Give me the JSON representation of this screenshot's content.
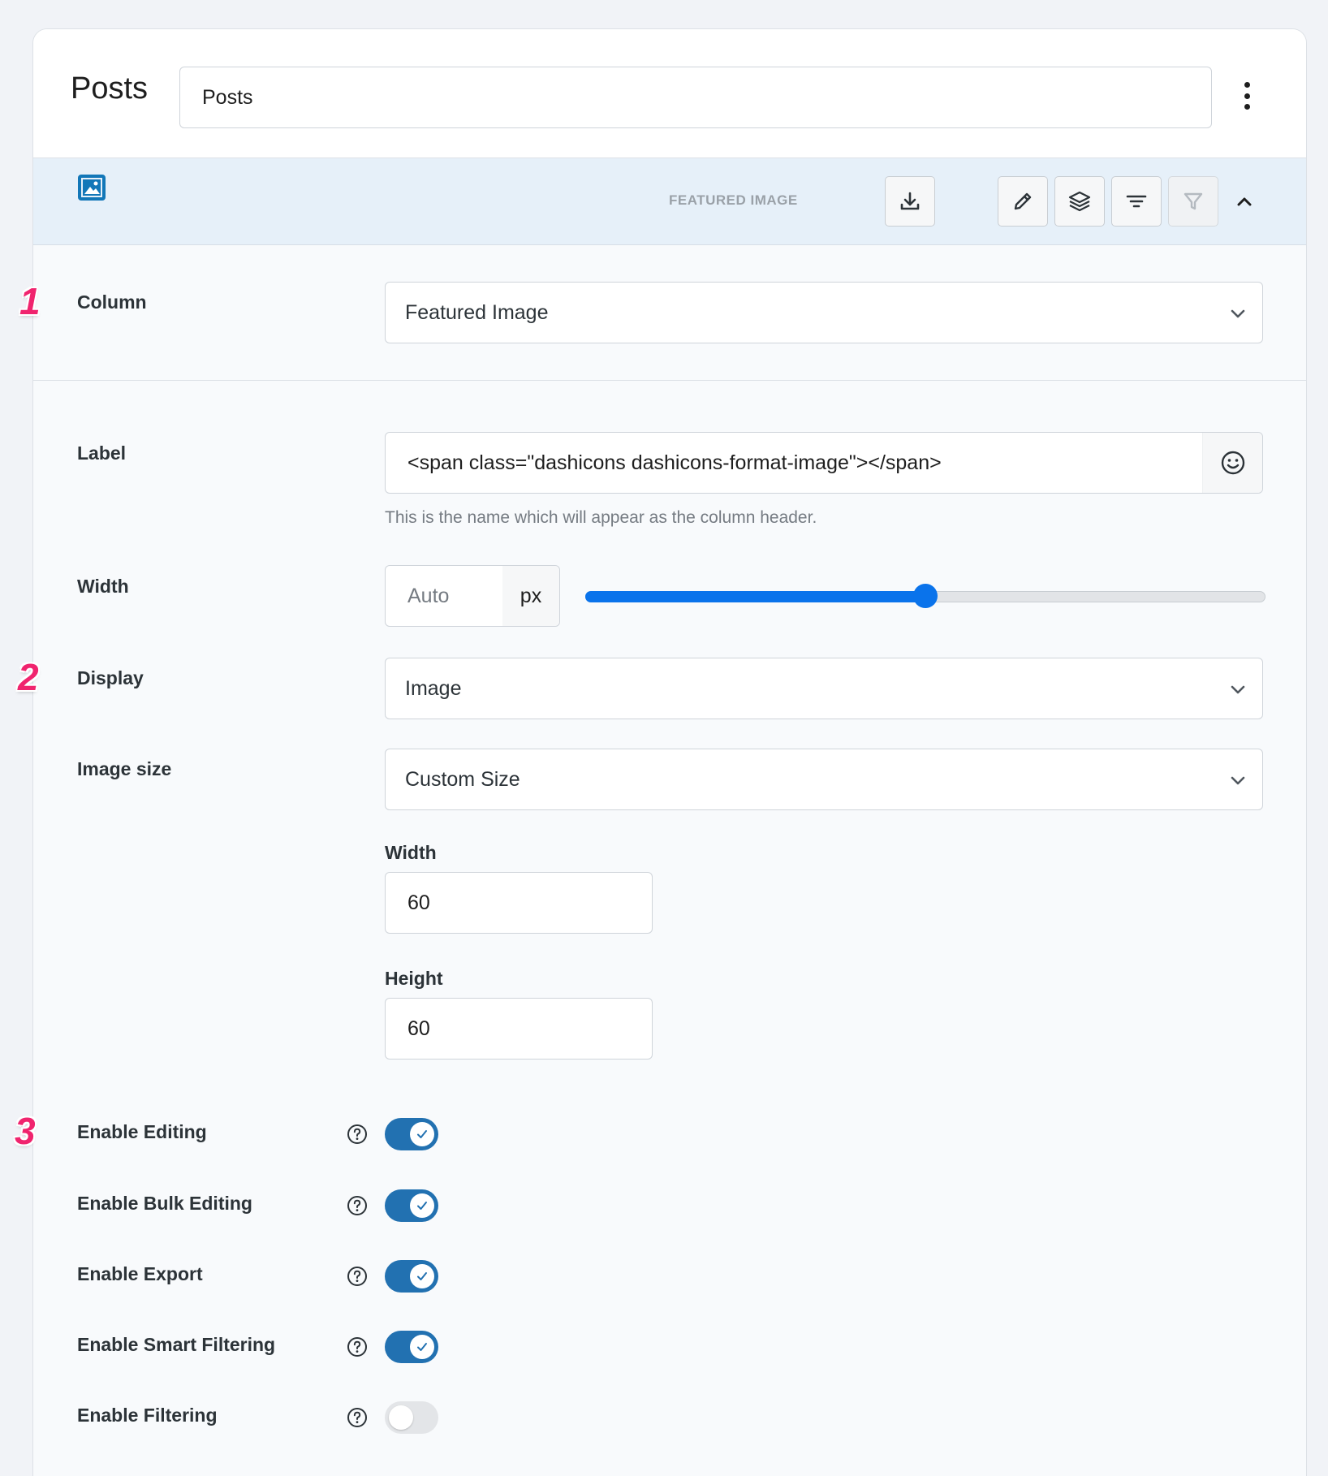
{
  "header": {
    "title": "Posts",
    "name_value": "Posts"
  },
  "column_bar": {
    "type_label": "FEATURED IMAGE",
    "icons": [
      "image-icon",
      "download-icon",
      "pencil-icon",
      "layers-icon",
      "sort-icon",
      "filter-icon",
      "chevron-up-icon"
    ]
  },
  "markers": [
    "1",
    "2",
    "3"
  ],
  "fields": {
    "column": {
      "label": "Column",
      "value": "Featured Image"
    },
    "label": {
      "label": "Label",
      "value": "<span class=\"dashicons dashicons-format-image\"></span>",
      "help": "This is the name which will appear as the column header."
    },
    "width": {
      "label": "Width",
      "value": "Auto",
      "unit": "px",
      "slider_fraction": 0.5
    },
    "display": {
      "label": "Display",
      "value": "Image"
    },
    "image_size": {
      "label": "Image size",
      "value": "Custom Size",
      "width_label": "Width",
      "width_value": "60",
      "height_label": "Height",
      "height_value": "60"
    }
  },
  "toggles": [
    {
      "label": "Enable Editing",
      "on": true
    },
    {
      "label": "Enable Bulk Editing",
      "on": true
    },
    {
      "label": "Enable Export",
      "on": true
    },
    {
      "label": "Enable Smart Filtering",
      "on": true
    },
    {
      "label": "Enable Filtering",
      "on": false
    }
  ],
  "colors": {
    "accent": "#2271b1",
    "slider": "#0a73eb",
    "marker": "#f0246e",
    "column_bar_bg": "#e6f0f9"
  }
}
